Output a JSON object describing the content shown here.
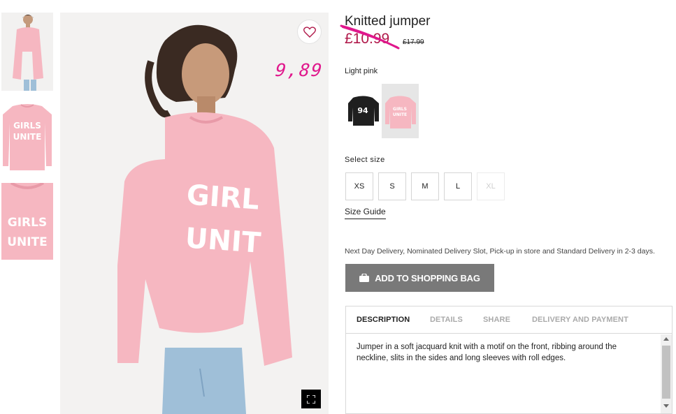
{
  "product": {
    "title": "Knitted jumper",
    "price_now": "£10.99",
    "price_old": "£17.99",
    "annotation_price": "9,89",
    "color_label": "Light pink",
    "swatches": [
      {
        "name": "black",
        "print": "94"
      },
      {
        "name": "light-pink",
        "print": "GIRLS UNITE"
      }
    ],
    "size_label": "Select size",
    "sizes": [
      {
        "label": "XS",
        "available": true
      },
      {
        "label": "S",
        "available": true
      },
      {
        "label": "M",
        "available": true
      },
      {
        "label": "L",
        "available": true
      },
      {
        "label": "XL",
        "available": false
      }
    ],
    "size_guide": "Size Guide",
    "delivery_note": "Next Day Delivery, Nominated Delivery Slot, Pick-up in store and Standard Delivery in 2-3 days.",
    "add_to_bag": "ADD TO SHOPPING BAG",
    "jumper_print": "GIRLS UNITE"
  },
  "tabs": {
    "items": [
      "DESCRIPTION",
      "DETAILS",
      "SHARE",
      "DELIVERY AND PAYMENT"
    ],
    "active": "DESCRIPTION",
    "description": "Jumper in a soft jacquard knit with a motif on the front, ribbing around the neckline, slits in the sides and long sleeves with roll edges."
  },
  "colors": {
    "price_sale": "#b0194a",
    "annotation": "#e0178c",
    "button": "#797979",
    "jumper": "#f6b7c1"
  },
  "icons": [
    "heart-icon",
    "expand-icon",
    "bag-icon",
    "scroll-up-icon",
    "scroll-down-icon"
  ]
}
